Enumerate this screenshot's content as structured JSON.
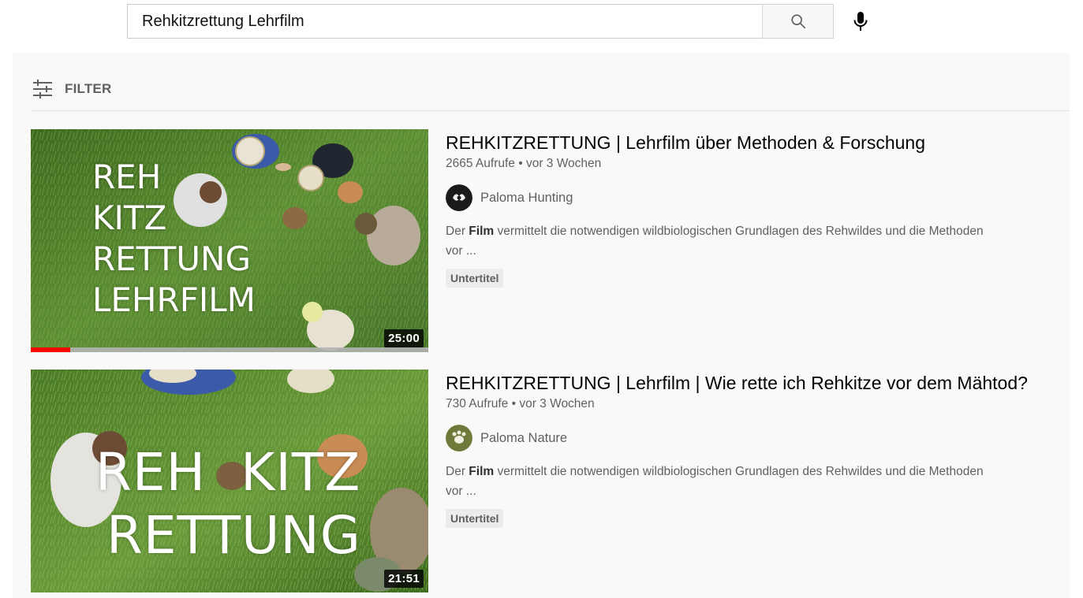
{
  "search": {
    "query": "Rehkitzrettung Lehrfilm"
  },
  "filter": {
    "label": "FILTER"
  },
  "results": [
    {
      "thumbnail_text": [
        "REH",
        "KITZ",
        "RETTUNG",
        "LEHRFILM"
      ],
      "duration": "25:00",
      "watch_progress_percent": 10,
      "title": "REHKITZRETTUNG | Lehrfilm über Methoden & Forschung",
      "meta": "2665 Aufrufe • vor 3 Wochen",
      "channel": "Paloma Hunting",
      "desc_before": "Der ",
      "desc_bold": "Film",
      "desc_after": " vermittelt die notwendigen wildbiologischen Grundlagen des Rehwildes und die Methoden",
      "desc_line2": "vor ...",
      "badge": "Untertitel"
    },
    {
      "thumbnail_text": [
        "REH  KITZ",
        "RETTUNG"
      ],
      "duration": "21:51",
      "title": "REHKITZRETTUNG | Lehrfilm | Wie rette ich Rehkitze vor dem Mähtod?",
      "meta": "730 Aufrufe • vor 3 Wochen",
      "channel": "Paloma Nature",
      "desc_before": "Der ",
      "desc_bold": "Film",
      "desc_after": " vermittelt die notwendigen wildbiologischen Grundlagen des Rehwildes und die Methoden",
      "desc_line2": "vor ...",
      "badge": "Untertitel"
    }
  ],
  "colors": {
    "progress": "#ff0000",
    "grass": "#4f7d2a",
    "channel1_avatar": "#1a1a1a",
    "channel2_avatar": "#6f7a3a"
  }
}
